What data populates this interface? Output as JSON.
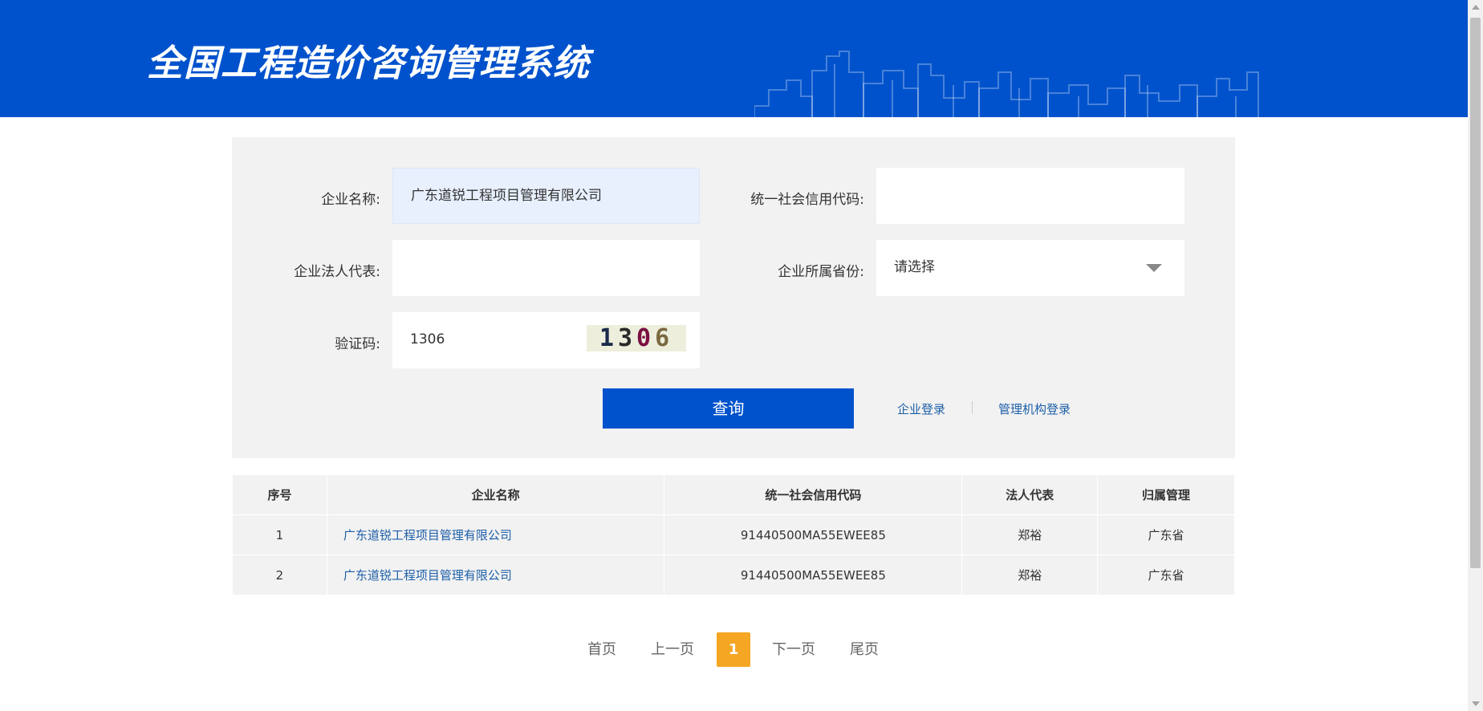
{
  "header": {
    "title": "全国工程造价咨询管理系统"
  },
  "form": {
    "company_name": {
      "label": "企业名称:",
      "value": "广东道锐工程项目管理有限公司"
    },
    "credit_code": {
      "label": "统一社会信用代码:",
      "value": ""
    },
    "legal_rep": {
      "label": "企业法人代表:",
      "value": ""
    },
    "province": {
      "label": "企业所属省份:",
      "value": "请选择"
    },
    "captcha": {
      "label": "验证码:",
      "value": "1306",
      "image_digits": [
        "1",
        "3",
        "0",
        "6"
      ]
    },
    "query_button": "查询",
    "company_login": "企业登录",
    "agency_login": "管理机构登录"
  },
  "table": {
    "columns": [
      "序号",
      "企业名称",
      "统一社会信用代码",
      "法人代表",
      "归属管理"
    ],
    "rows": [
      {
        "index": "1",
        "name": "广东道锐工程项目管理有限公司",
        "code": "91440500MA55EWEE85",
        "rep": "郑裕",
        "region": "广东省"
      },
      {
        "index": "2",
        "name": "广东道锐工程项目管理有限公司",
        "code": "91440500MA55EWEE85",
        "rep": "郑裕",
        "region": "广东省"
      }
    ]
  },
  "pagination": {
    "first": "首页",
    "prev": "上一页",
    "current": "1",
    "next": "下一页",
    "last": "尾页"
  },
  "colors": {
    "brand_blue": "#0052cc",
    "link_blue": "#1d5fa8",
    "pager_active": "#f5a623",
    "panel_bg": "#f2f2f2"
  }
}
